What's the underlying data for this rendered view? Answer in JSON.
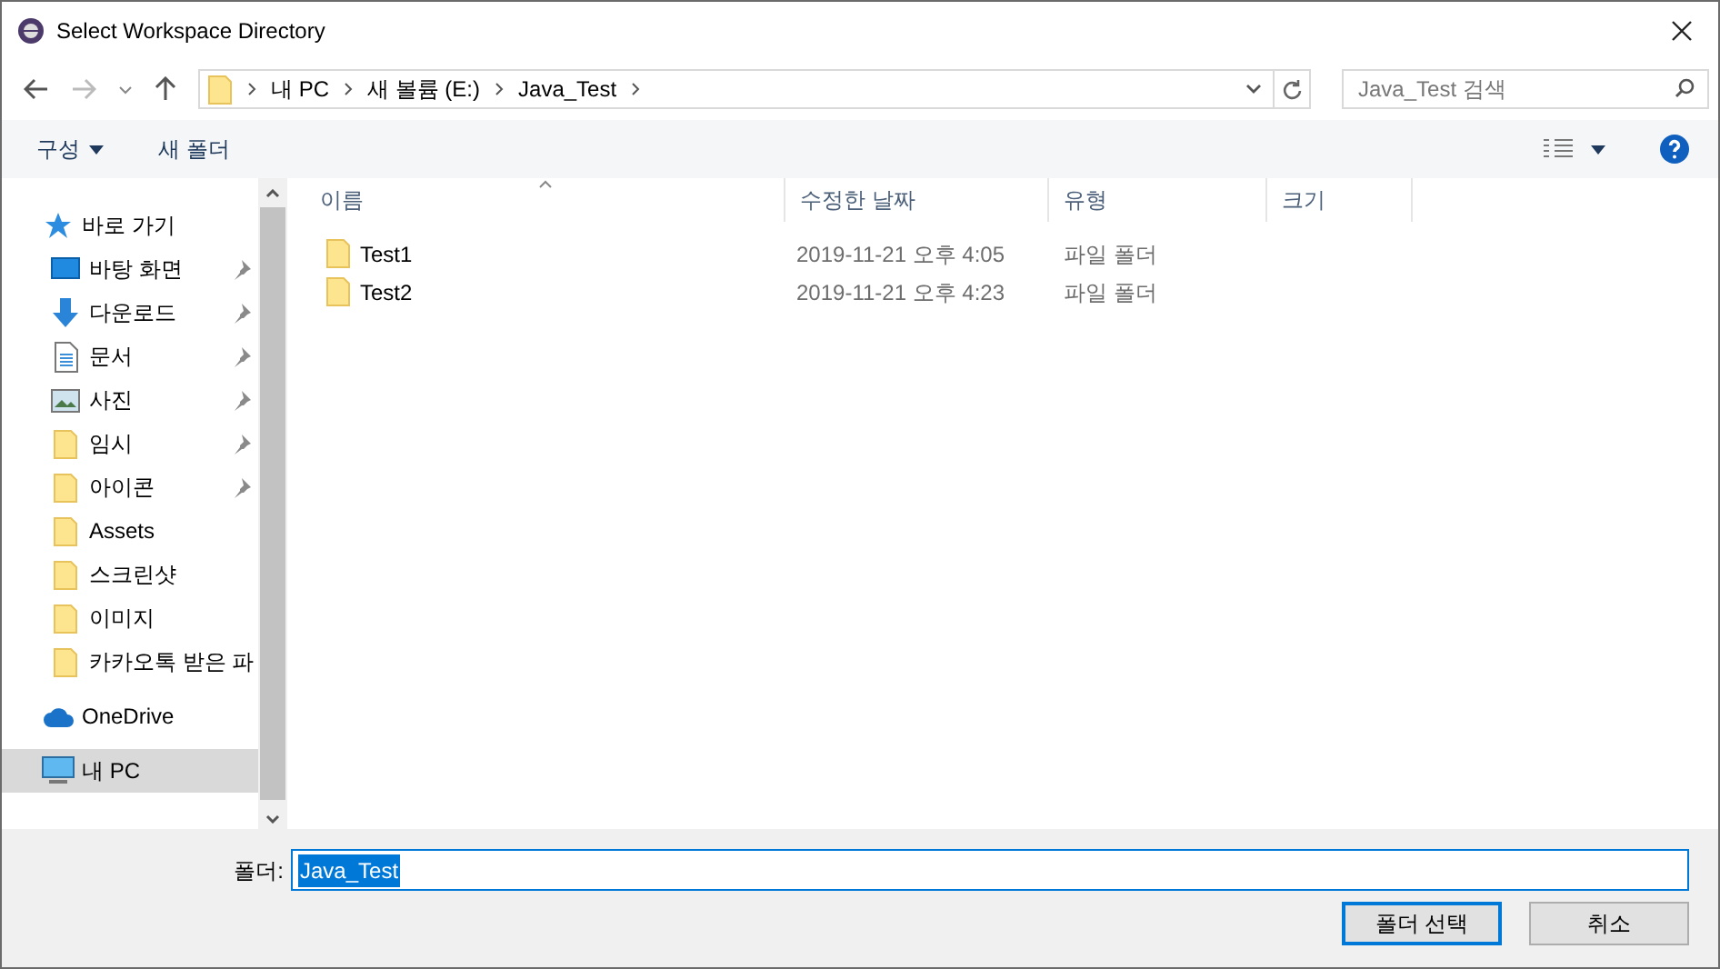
{
  "window": {
    "title": "Select Workspace Directory"
  },
  "address": {
    "crumbs": [
      "내 PC",
      "새 볼륨 (E:)",
      "Java_Test"
    ]
  },
  "search": {
    "placeholder": "Java_Test 검색"
  },
  "toolbar": {
    "organize": "구성",
    "new_folder": "새 폴더"
  },
  "sidebar": {
    "items": [
      {
        "label": "바로 가기",
        "kind": "star",
        "selected": false,
        "children": [
          {
            "label": "바탕 화면",
            "kind": "desktop",
            "pinned": true,
            "selected": false
          },
          {
            "label": "다운로드",
            "kind": "download",
            "pinned": true,
            "selected": false
          },
          {
            "label": "문서",
            "kind": "document",
            "pinned": true,
            "selected": false
          },
          {
            "label": "사진",
            "kind": "picture",
            "pinned": true,
            "selected": false
          },
          {
            "label": "임시",
            "kind": "folder",
            "pinned": true,
            "selected": false
          },
          {
            "label": "아이콘",
            "kind": "folder",
            "pinned": true,
            "selected": false
          },
          {
            "label": "Assets",
            "kind": "folder",
            "pinned": false,
            "selected": false
          },
          {
            "label": "스크린샷",
            "kind": "folder",
            "pinned": false,
            "selected": false
          },
          {
            "label": "이미지",
            "kind": "folder",
            "pinned": false,
            "selected": false
          },
          {
            "label": "카카오톡 받은 파",
            "kind": "folder",
            "pinned": false,
            "selected": false
          }
        ]
      },
      {
        "label": "OneDrive",
        "kind": "cloud",
        "selected": false
      },
      {
        "label": "내 PC",
        "kind": "pc",
        "selected": true
      }
    ]
  },
  "table": {
    "columns": [
      "이름",
      "수정한 날짜",
      "유형",
      "크기"
    ],
    "rows": [
      {
        "name": "Test1",
        "modified": "2019-11-21 오후 4:05",
        "type": "파일 폴더"
      },
      {
        "name": "Test2",
        "modified": "2019-11-21 오후 4:23",
        "type": "파일 폴더"
      }
    ]
  },
  "footer": {
    "folder_label": "폴더:",
    "folder_value": "Java_Test",
    "buttons": [
      {
        "label": "폴더 선택",
        "kind": "primary"
      },
      {
        "label": "취소",
        "kind": "secondary"
      }
    ]
  }
}
